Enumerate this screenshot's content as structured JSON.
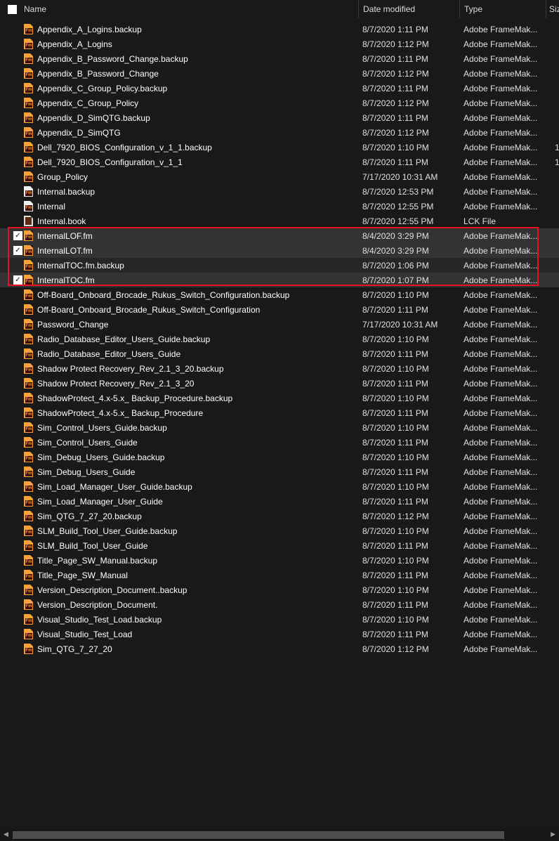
{
  "columns": {
    "name": "Name",
    "date_modified": "Date modified",
    "type": "Type",
    "size": "Size"
  },
  "colors": {
    "background": "#191919",
    "selected_row": "#333333",
    "highlight_border": "#e81123",
    "fm_icon": "#f7a23b"
  },
  "rows": [
    {
      "name": "Appendix_A_Logins.backup",
      "date": "8/7/2020 1:11 PM",
      "type": "Adobe FrameMak...",
      "size": "",
      "icon": "framemaker-icon",
      "checked": false
    },
    {
      "name": "Appendix_A_Logins",
      "date": "8/7/2020 1:12 PM",
      "type": "Adobe FrameMak...",
      "size": "",
      "icon": "framemaker-icon",
      "checked": false
    },
    {
      "name": "Appendix_B_Password_Change.backup",
      "date": "8/7/2020 1:11 PM",
      "type": "Adobe FrameMak...",
      "size": "",
      "icon": "framemaker-icon",
      "checked": false
    },
    {
      "name": "Appendix_B_Password_Change",
      "date": "8/7/2020 1:12 PM",
      "type": "Adobe FrameMak...",
      "size": "",
      "icon": "framemaker-icon",
      "checked": false
    },
    {
      "name": "Appendix_C_Group_Policy.backup",
      "date": "8/7/2020 1:11 PM",
      "type": "Adobe FrameMak...",
      "size": "",
      "icon": "framemaker-icon",
      "checked": false
    },
    {
      "name": "Appendix_C_Group_Policy",
      "date": "8/7/2020 1:12 PM",
      "type": "Adobe FrameMak...",
      "size": "",
      "icon": "framemaker-icon",
      "checked": false
    },
    {
      "name": "Appendix_D_SimQTG.backup",
      "date": "8/7/2020 1:11 PM",
      "type": "Adobe FrameMak...",
      "size": "",
      "icon": "framemaker-icon",
      "checked": false
    },
    {
      "name": "Appendix_D_SimQTG",
      "date": "8/7/2020 1:12 PM",
      "type": "Adobe FrameMak...",
      "size": "",
      "icon": "framemaker-icon",
      "checked": false
    },
    {
      "name": "Dell_7920_BIOS_Configuration_v_1_1.backup",
      "date": "8/7/2020 1:10 PM",
      "type": "Adobe FrameMak...",
      "size": "1",
      "icon": "framemaker-icon",
      "checked": false
    },
    {
      "name": "Dell_7920_BIOS_Configuration_v_1_1",
      "date": "8/7/2020 1:11 PM",
      "type": "Adobe FrameMak...",
      "size": "1",
      "icon": "framemaker-icon",
      "checked": false
    },
    {
      "name": "Group_Policy",
      "date": "7/17/2020 10:31 AM",
      "type": "Adobe FrameMak...",
      "size": "",
      "icon": "framemaker-icon",
      "checked": false
    },
    {
      "name": "Internal.backup",
      "date": "8/7/2020 12:53 PM",
      "type": "Adobe FrameMak...",
      "size": "",
      "icon": "framemaker-book-icon",
      "checked": false
    },
    {
      "name": "Internal",
      "date": "8/7/2020 12:55 PM",
      "type": "Adobe FrameMak...",
      "size": "",
      "icon": "framemaker-book-icon",
      "checked": false
    },
    {
      "name": "Internal.book",
      "date": "8/7/2020 12:55 PM",
      "type": "LCK File",
      "size": "",
      "icon": "lck-file-icon",
      "checked": false
    },
    {
      "name": "InternalLOF.fm",
      "date": "8/4/2020 3:29 PM",
      "type": "Adobe FrameMak...",
      "size": "",
      "icon": "framemaker-icon",
      "checked": true
    },
    {
      "name": "InternalLOT.fm",
      "date": "8/4/2020 3:29 PM",
      "type": "Adobe FrameMak...",
      "size": "",
      "icon": "framemaker-icon",
      "checked": true
    },
    {
      "name": "InternalTOC.fm.backup",
      "date": "8/7/2020 1:06 PM",
      "type": "Adobe FrameMak...",
      "size": "",
      "icon": "framemaker-icon",
      "checked": false
    },
    {
      "name": "InternalTOC.fm",
      "date": "8/7/2020 1:07 PM",
      "type": "Adobe FrameMak...",
      "size": "",
      "icon": "framemaker-icon",
      "checked": true
    },
    {
      "name": "Off-Board_Onboard_Brocade_Rukus_Switch_Configuration.backup",
      "date": "8/7/2020 1:10 PM",
      "type": "Adobe FrameMak...",
      "size": "",
      "icon": "framemaker-icon",
      "checked": false
    },
    {
      "name": "Off-Board_Onboard_Brocade_Rukus_Switch_Configuration",
      "date": "8/7/2020 1:11 PM",
      "type": "Adobe FrameMak...",
      "size": "",
      "icon": "framemaker-icon",
      "checked": false
    },
    {
      "name": "Password_Change",
      "date": "7/17/2020 10:31 AM",
      "type": "Adobe FrameMak...",
      "size": "",
      "icon": "framemaker-icon",
      "checked": false
    },
    {
      "name": "Radio_Database_Editor_Users_Guide.backup",
      "date": "8/7/2020 1:10 PM",
      "type": "Adobe FrameMak...",
      "size": "",
      "icon": "framemaker-icon",
      "checked": false
    },
    {
      "name": "Radio_Database_Editor_Users_Guide",
      "date": "8/7/2020 1:11 PM",
      "type": "Adobe FrameMak...",
      "size": "",
      "icon": "framemaker-icon",
      "checked": false
    },
    {
      "name": "Shadow Protect Recovery_Rev_2.1_3_20.backup",
      "date": "8/7/2020 1:10 PM",
      "type": "Adobe FrameMak...",
      "size": "",
      "icon": "framemaker-icon",
      "checked": false
    },
    {
      "name": "Shadow Protect Recovery_Rev_2.1_3_20",
      "date": "8/7/2020 1:11 PM",
      "type": "Adobe FrameMak...",
      "size": "",
      "icon": "framemaker-icon",
      "checked": false
    },
    {
      "name": "ShadowProtect_4.x-5.x_ Backup_Procedure.backup",
      "date": "8/7/2020 1:10 PM",
      "type": "Adobe FrameMak...",
      "size": "",
      "icon": "framemaker-icon",
      "checked": false
    },
    {
      "name": "ShadowProtect_4.x-5.x_ Backup_Procedure",
      "date": "8/7/2020 1:11 PM",
      "type": "Adobe FrameMak...",
      "size": "",
      "icon": "framemaker-icon",
      "checked": false
    },
    {
      "name": "Sim_Control_Users_Guide.backup",
      "date": "8/7/2020 1:10 PM",
      "type": "Adobe FrameMak...",
      "size": "",
      "icon": "framemaker-icon",
      "checked": false
    },
    {
      "name": "Sim_Control_Users_Guide",
      "date": "8/7/2020 1:11 PM",
      "type": "Adobe FrameMak...",
      "size": "",
      "icon": "framemaker-icon",
      "checked": false
    },
    {
      "name": "Sim_Debug_Users_Guide.backup",
      "date": "8/7/2020 1:10 PM",
      "type": "Adobe FrameMak...",
      "size": "",
      "icon": "framemaker-icon",
      "checked": false
    },
    {
      "name": "Sim_Debug_Users_Guide",
      "date": "8/7/2020 1:11 PM",
      "type": "Adobe FrameMak...",
      "size": "",
      "icon": "framemaker-icon",
      "checked": false
    },
    {
      "name": "Sim_Load_Manager_User_Guide.backup",
      "date": "8/7/2020 1:10 PM",
      "type": "Adobe FrameMak...",
      "size": "",
      "icon": "framemaker-icon",
      "checked": false
    },
    {
      "name": "Sim_Load_Manager_User_Guide",
      "date": "8/7/2020 1:11 PM",
      "type": "Adobe FrameMak...",
      "size": "",
      "icon": "framemaker-icon",
      "checked": false
    },
    {
      "name": "Sim_QTG_7_27_20.backup",
      "date": "8/7/2020 1:12 PM",
      "type": "Adobe FrameMak...",
      "size": "",
      "icon": "framemaker-icon",
      "checked": false
    },
    {
      "name": "SLM_Build_Tool_User_Guide.backup",
      "date": "8/7/2020 1:10 PM",
      "type": "Adobe FrameMak...",
      "size": "",
      "icon": "framemaker-icon",
      "checked": false
    },
    {
      "name": "SLM_Build_Tool_User_Guide",
      "date": "8/7/2020 1:11 PM",
      "type": "Adobe FrameMak...",
      "size": "",
      "icon": "framemaker-icon",
      "checked": false
    },
    {
      "name": "Title_Page_SW_Manual.backup",
      "date": "8/7/2020 1:10 PM",
      "type": "Adobe FrameMak...",
      "size": "",
      "icon": "framemaker-icon",
      "checked": false
    },
    {
      "name": "Title_Page_SW_Manual",
      "date": "8/7/2020 1:11 PM",
      "type": "Adobe FrameMak...",
      "size": "",
      "icon": "framemaker-icon",
      "checked": false
    },
    {
      "name": "Version_Description_Document..backup",
      "date": "8/7/2020 1:10 PM",
      "type": "Adobe FrameMak...",
      "size": "",
      "icon": "framemaker-icon",
      "checked": false
    },
    {
      "name": "Version_Description_Document.",
      "date": "8/7/2020 1:11 PM",
      "type": "Adobe FrameMak...",
      "size": "",
      "icon": "framemaker-icon",
      "checked": false
    },
    {
      "name": "Visual_Studio_Test_Load.backup",
      "date": "8/7/2020 1:10 PM",
      "type": "Adobe FrameMak...",
      "size": "",
      "icon": "framemaker-icon",
      "checked": false
    },
    {
      "name": "Visual_Studio_Test_Load",
      "date": "8/7/2020 1:11 PM",
      "type": "Adobe FrameMak...",
      "size": "",
      "icon": "framemaker-icon",
      "checked": false
    },
    {
      "name": "Sim_QTG_7_27_20",
      "date": "8/7/2020 1:12 PM",
      "type": "Adobe FrameMak...",
      "size": "",
      "icon": "framemaker-icon",
      "checked": false
    }
  ]
}
